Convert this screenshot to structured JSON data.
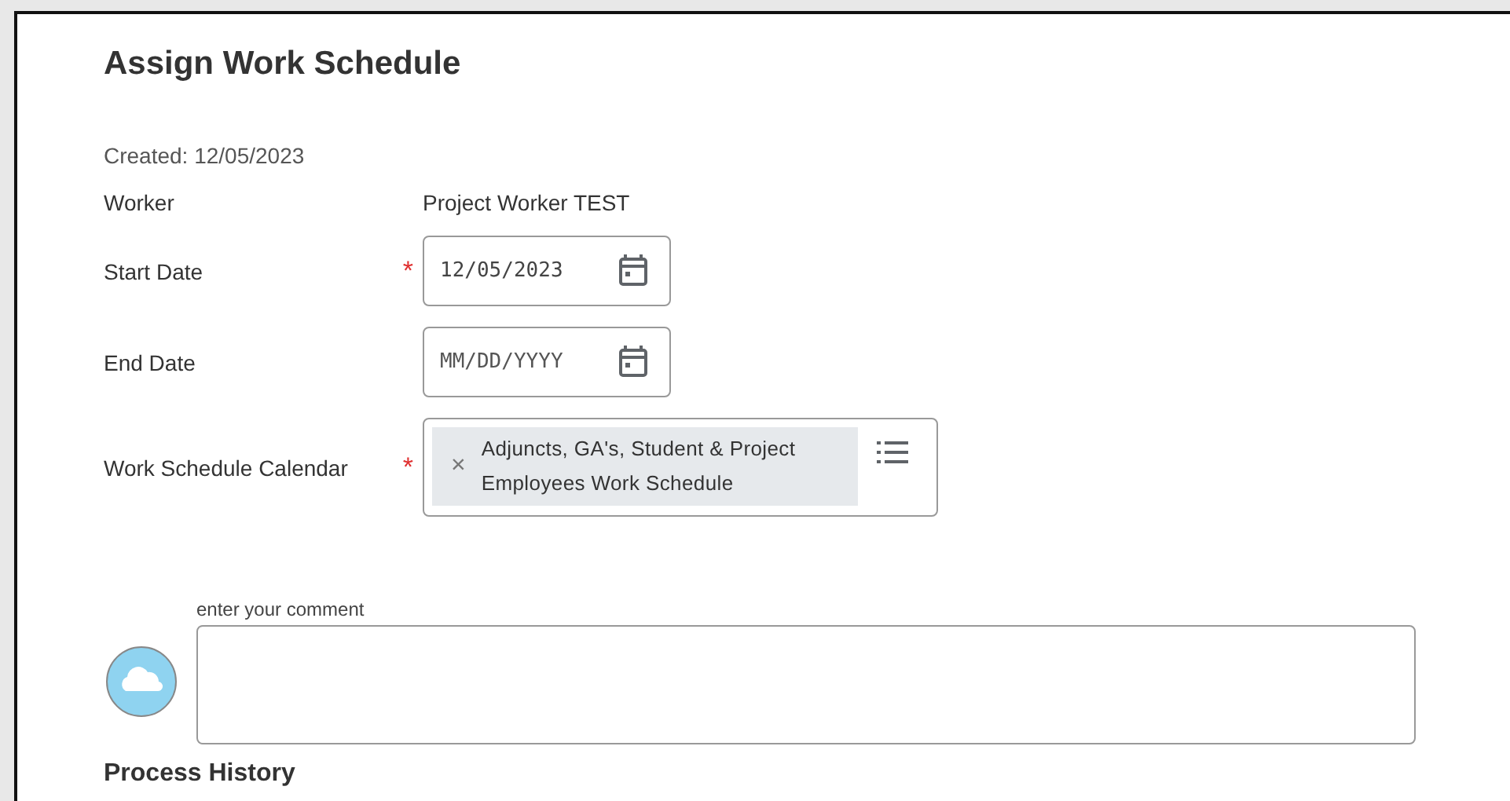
{
  "title": "Assign Work Schedule",
  "created": "Created: 12/05/2023",
  "fields": [
    {
      "kind": "text",
      "label": "Worker",
      "required": false,
      "value": "Project Worker TEST"
    },
    {
      "kind": "date",
      "label": "Start Date",
      "required": true,
      "value": "12/05/2023"
    },
    {
      "kind": "date",
      "label": "End Date",
      "required": false,
      "placeholder": "MM/DD/YYYY"
    },
    {
      "kind": "multiselect",
      "label": "Work Schedule Calendar",
      "required": true,
      "chips": [
        {
          "remove": "×",
          "text": "Adjuncts, GA's, Student & Project Employees Work Schedule"
        }
      ]
    }
  ],
  "required_mark": "*",
  "comment": {
    "label": "enter your comment"
  },
  "section_heading": "Process History"
}
